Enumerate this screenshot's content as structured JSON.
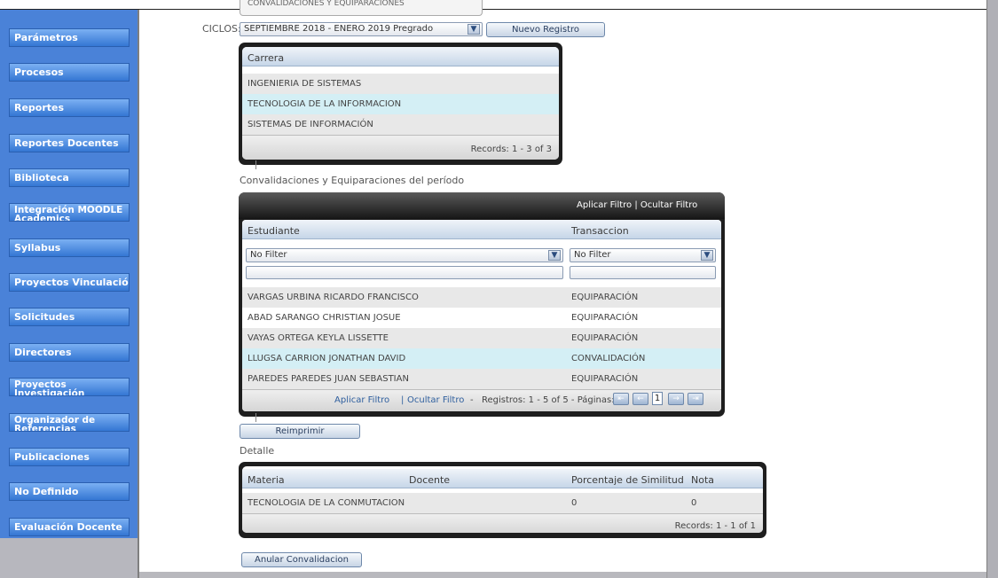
{
  "sidebar": {
    "items": [
      {
        "label": "Parámetros"
      },
      {
        "label": "Procesos"
      },
      {
        "label": "Reportes"
      },
      {
        "label": "Reportes Docentes"
      },
      {
        "label": "Biblioteca"
      },
      {
        "label": "Integración MOODLE Academics"
      },
      {
        "label": "Syllabus"
      },
      {
        "label": "Proyectos Vinculación"
      },
      {
        "label": "Solicitudes"
      },
      {
        "label": "Directores"
      },
      {
        "label": "Proyectos Investigación"
      },
      {
        "label": "Organizador de Referencias"
      },
      {
        "label": "Publicaciones"
      },
      {
        "label": "No Definido"
      },
      {
        "label": "Evaluación Docente"
      }
    ]
  },
  "top": {
    "ghost_label": "CONVALIDACIONES Y EQUIPARACIONES",
    "ciclos_label": "CICLOS:",
    "ciclo_value": "SEPTIEMBRE 2018 - ENERO 2019 Pregrado",
    "nuevo_button": "Nuevo Registro"
  },
  "carrera_grid": {
    "header": "Carrera",
    "rows": [
      "INGENIERIA DE SISTEMAS",
      "TECNOLOGIA DE LA INFORMACION",
      "SISTEMAS DE INFORMACIÓN"
    ],
    "footer": "Records: 1 - 3 of 3"
  },
  "conv": {
    "title": "Convalidaciones y Equiparaciones del período",
    "top_links": "Aplicar Filtro | Ocultar Filtro",
    "col_estudiante": "Estudiante",
    "col_transaccion": "Transaccion",
    "filter_value": "No Filter",
    "rows": [
      {
        "estudiante": "VARGAS URBINA RICARDO FRANCISCO",
        "transaccion": "EQUIPARACIÓN"
      },
      {
        "estudiante": "ABAD SARANGO CHRISTIAN JOSUE",
        "transaccion": "EQUIPARACIÓN"
      },
      {
        "estudiante": "VAYAS ORTEGA KEYLA LISSETTE",
        "transaccion": "EQUIPARACIÓN"
      },
      {
        "estudiante": "LLUGSA CARRION JONATHAN DAVID",
        "transaccion": "CONVALIDACIÓN"
      },
      {
        "estudiante": "PAREDES PAREDES  JUAN SEBASTIAN",
        "transaccion": "EQUIPARACIÓN"
      }
    ],
    "footer_aplicar": "Aplicar Filtro",
    "footer_sep": "|",
    "footer_ocultar": "Ocultar Filtro",
    "footer_dash": "-",
    "footer_records": "Registros: 1 - 5 of 5 - Páginas:",
    "page_current": "1"
  },
  "reimprimir_button": "Reimprimir",
  "detalle": {
    "title": "Detalle",
    "col_materia": "Materia",
    "col_docente": "Docente",
    "col_porcentaje": "Porcentaje de Similitud",
    "col_nota": "Nota",
    "rows": [
      {
        "materia": "TECNOLOGIA DE LA CONMUTACION",
        "docente": "",
        "porcentaje": "0",
        "nota": "0"
      }
    ],
    "footer": "Records: 1 - 1 of 1"
  },
  "anular_button": "Anular Convalidacion",
  "icons": {
    "dropdown": "chevron-down-icon",
    "first": "first-page-icon",
    "prev": "prev-page-icon",
    "next": "next-page-icon",
    "last": "last-page-icon"
  },
  "colors": {
    "sidebar": "#4a82d8",
    "selected_row": "#d4eff5",
    "panel_border": "#1e1e1e"
  }
}
